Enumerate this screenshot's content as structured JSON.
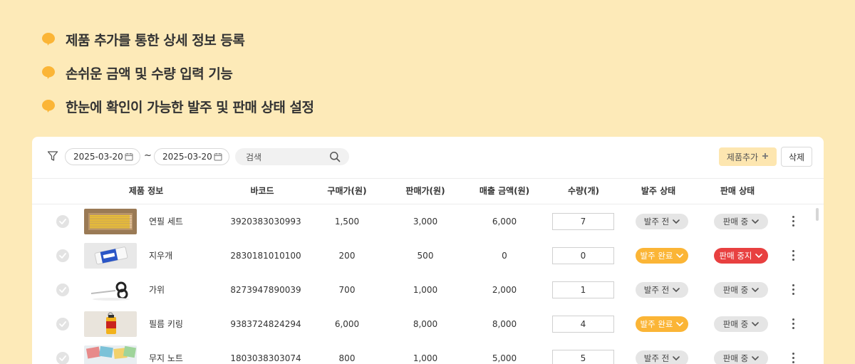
{
  "features": [
    "제품 추가를 통한 상세 정보 등록",
    "손쉬운 금액 및 수량 입력 기능",
    "한눈에 확인이 가능한 발주 및 판매 상태 설정"
  ],
  "toolbar": {
    "date_from": "2025-03-20",
    "tilde": "~",
    "date_to": "2025-03-20",
    "search_placeholder": "검색",
    "add_button": "제품추가",
    "delete_button": "삭제"
  },
  "columns": {
    "product": "제품 정보",
    "barcode": "바코드",
    "buy_price": "구매가(원)",
    "sell_price": "판매가(원)",
    "sales_amount": "매출 금액(원)",
    "quantity": "수량(개)",
    "order_status": "발주 상태",
    "sale_status": "판매 상태"
  },
  "rows": [
    {
      "name": "연필 세트",
      "thumb": "pencil-set",
      "barcode": "3920383030993",
      "buy": "1,500",
      "sell": "3,000",
      "sales": "6,000",
      "qty": "7",
      "order": "발주 전",
      "order_color": "gray",
      "sale": "판매 중",
      "sale_color": "gray"
    },
    {
      "name": "지우개",
      "thumb": "eraser",
      "barcode": "2830181010100",
      "buy": "200",
      "sell": "500",
      "sales": "0",
      "qty": "0",
      "order": "발주 완료",
      "order_color": "orange",
      "sale": "판매 중지",
      "sale_color": "red"
    },
    {
      "name": "가위",
      "thumb": "scissors",
      "barcode": "8273947890039",
      "buy": "700",
      "sell": "1,000",
      "sales": "2,000",
      "qty": "1",
      "order": "발주 전",
      "order_color": "gray",
      "sale": "판매 중",
      "sale_color": "gray"
    },
    {
      "name": "필름 키링",
      "thumb": "film-keyring",
      "barcode": "9383724824294",
      "buy": "6,000",
      "sell": "8,000",
      "sales": "8,000",
      "qty": "4",
      "order": "발주 완료",
      "order_color": "orange",
      "sale": "판매 중",
      "sale_color": "gray"
    },
    {
      "name": "무지 노트",
      "thumb": "notebook",
      "barcode": "1803038303074",
      "buy": "800",
      "sell": "1,000",
      "sales": "5,000",
      "qty": "5",
      "order": "발주 전",
      "order_color": "gray",
      "sale": "판매 중",
      "sale_color": "gray"
    }
  ],
  "colors": {
    "background": "#fdeab8",
    "bubble": "#fbb536",
    "orange": "#fbb536",
    "red": "#e84040",
    "gray_pill": "#e5e5e5"
  }
}
